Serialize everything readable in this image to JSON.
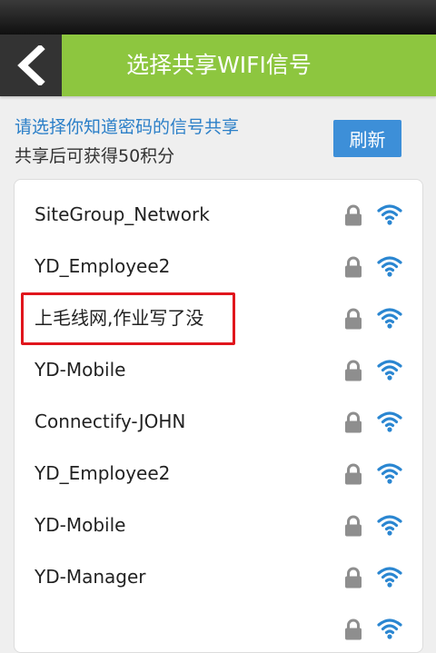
{
  "header": {
    "title": "选择共享WIFI信号",
    "back_icon": "chevron-left-icon"
  },
  "hint": {
    "line1": "请选择你知道密码的信号共享",
    "line2": "共享后可获得50积分"
  },
  "refresh_label": "刷新",
  "networks": [
    {
      "name": "SiteGroup_Network",
      "locked": true,
      "signal": "strong"
    },
    {
      "name": "YD_Employee2",
      "locked": true,
      "signal": "strong"
    },
    {
      "name": "上毛线网,作业写了没",
      "locked": true,
      "signal": "strong",
      "highlighted": true
    },
    {
      "name": "YD-Mobile",
      "locked": true,
      "signal": "strong"
    },
    {
      "name": "Connectify-JOHN",
      "locked": true,
      "signal": "strong"
    },
    {
      "name": "YD_Employee2",
      "locked": true,
      "signal": "strong"
    },
    {
      "name": "YD-Mobile",
      "locked": true,
      "signal": "strong"
    },
    {
      "name": "YD-Manager",
      "locked": true,
      "signal": "strong"
    }
  ],
  "colors": {
    "title_bar": "#8dc63f",
    "back_button": "#333333",
    "accent_blue": "#2b7fc8",
    "refresh_button": "#3d8fd8",
    "highlight": "#e0161c",
    "lock_gray": "#8e8e8e",
    "wifi_blue": "#2a86d1"
  }
}
